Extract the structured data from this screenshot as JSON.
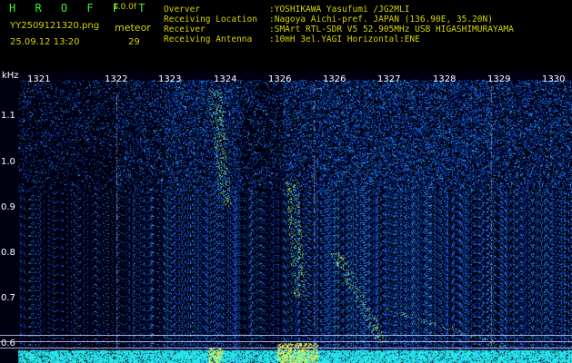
{
  "header": {
    "app_title": "H R O F F T",
    "version": "1.0.0f",
    "filename": "YY2509121320.png",
    "datetime": "25.09.12 13:20",
    "mode_label": "meteor",
    "count": "29"
  },
  "station_info": [
    {
      "label": "Overver",
      "value": ":YOSHIKAWA Yasufumi /JG2MLI"
    },
    {
      "label": "Receiving Location",
      "value": ":Nagoya Aichi-pref. JAPAN (136.90E, 35.20N)"
    },
    {
      "label": "Receiver",
      "value": ":SMArt RTL-SDR V5 52.905MHz USB HIGASHIMURAYAMA"
    },
    {
      "label": "Receiving Antenna",
      "value": ":10mH 3el.YAGI Horizontal:ENE"
    }
  ],
  "spectrogram": {
    "y_unit": "kHz",
    "y_ticks": [
      "1.1",
      "1.0",
      "0.9",
      "0.8",
      "0.7",
      "0.6"
    ],
    "time_ticks": [
      "1321",
      "1322",
      "1323",
      "1324",
      "1326",
      "1326",
      "1327",
      "1328",
      "1329",
      "1330"
    ],
    "colors": {
      "background": "#000010",
      "noise": "#1e50c8",
      "signal": "#d0ff40",
      "text": "#d4d400"
    }
  }
}
